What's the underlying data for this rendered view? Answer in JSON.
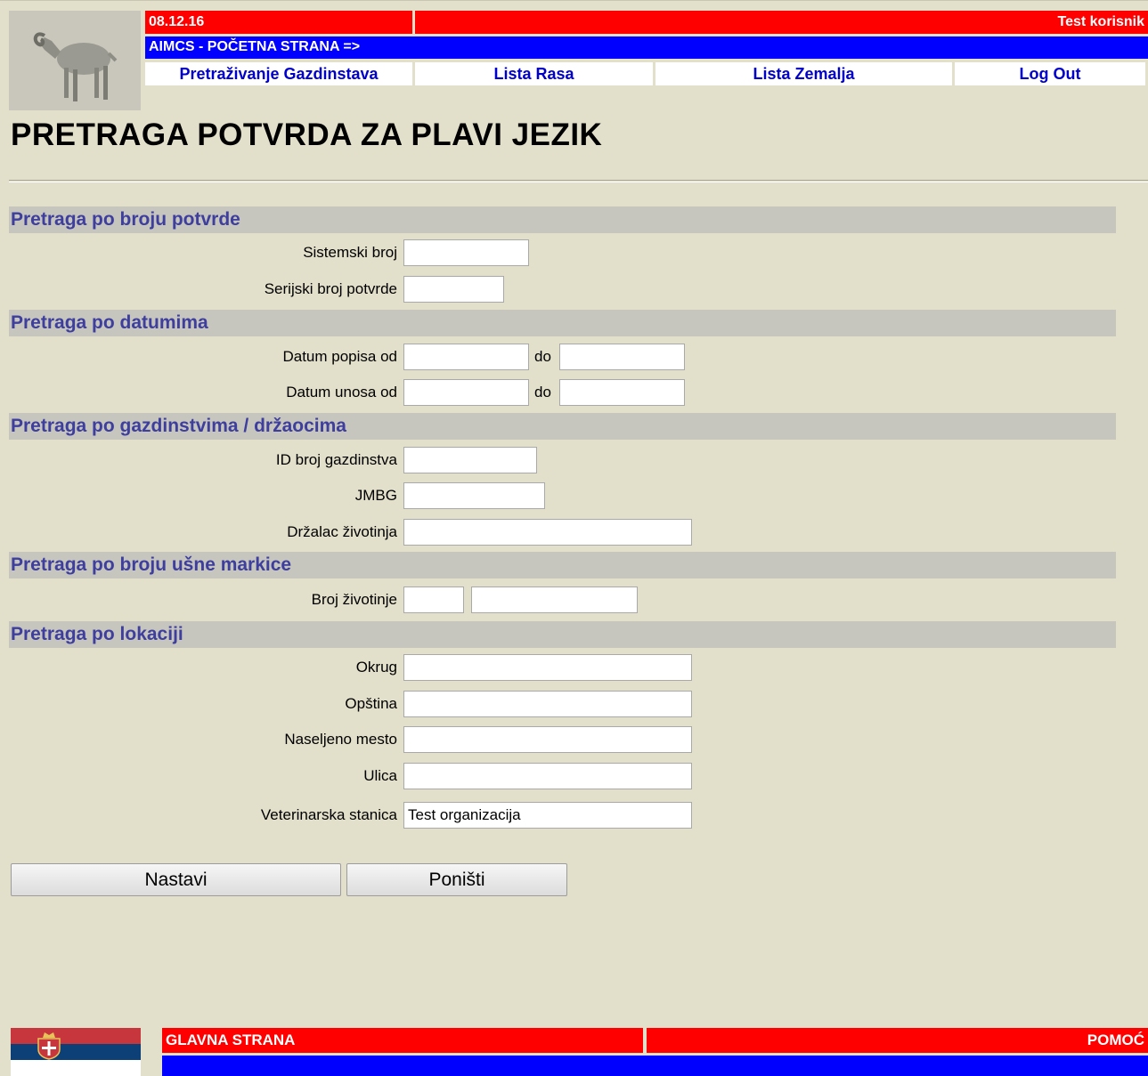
{
  "header": {
    "date": "08.12.16",
    "user": "Test korisnik",
    "home_link": "AIMCS - POČETNA STRANA  =>",
    "nav": [
      {
        "label": "Pretraživanje Gazdinstava"
      },
      {
        "label": "Lista Rasa"
      },
      {
        "label": "Lista Zemalja"
      },
      {
        "label": "Log Out"
      }
    ]
  },
  "page": {
    "title": "PRETRAGA POTVRDA ZA PLAVI JEZIK"
  },
  "sections": {
    "by_number": {
      "title": "Pretraga po broju potvrde",
      "system_number_label": "Sistemski broj",
      "system_number_value": "",
      "serial_number_label": "Serijski broj potvrde",
      "serial_number_value": ""
    },
    "by_dates": {
      "title": "Pretraga po datumima",
      "census_from_label": "Datum popisa od",
      "census_to_label": "do",
      "entry_from_label": "Datum unosa od",
      "entry_to_label": "do"
    },
    "by_holdings": {
      "title": "Pretraga po gazdinstvima / držaocima",
      "holding_id_label": "ID broj gazdinstva",
      "jmbg_label": "JMBG",
      "keeper_label": "Držalac životinja"
    },
    "by_eartag": {
      "title": "Pretraga po broju ušne markice",
      "animal_number_label": "Broj životinje"
    },
    "by_location": {
      "title": "Pretraga po lokaciji",
      "district_label": "Okrug",
      "municipality_label": "Opština",
      "settlement_label": "Naseljeno mesto",
      "street_label": "Ulica",
      "vet_station_label": "Veterinarska stanica",
      "vet_station_value": "Test organizacija"
    }
  },
  "buttons": {
    "continue_label": "Nastavi",
    "reset_label": "Poništi"
  },
  "footer": {
    "home_label": "GLAVNA STRANA",
    "help_label": "POMOĆ"
  },
  "colors": {
    "background": "#e2dfca",
    "red_bar": "#ff0000",
    "blue_bar": "#0000ff",
    "nav_link": "#0000cc",
    "section_text": "#3e3e9e",
    "section_band": "#c6c5be"
  },
  "icons": {
    "logo": "ram-sheep-icon",
    "flag": "serbia-flag-icon"
  }
}
